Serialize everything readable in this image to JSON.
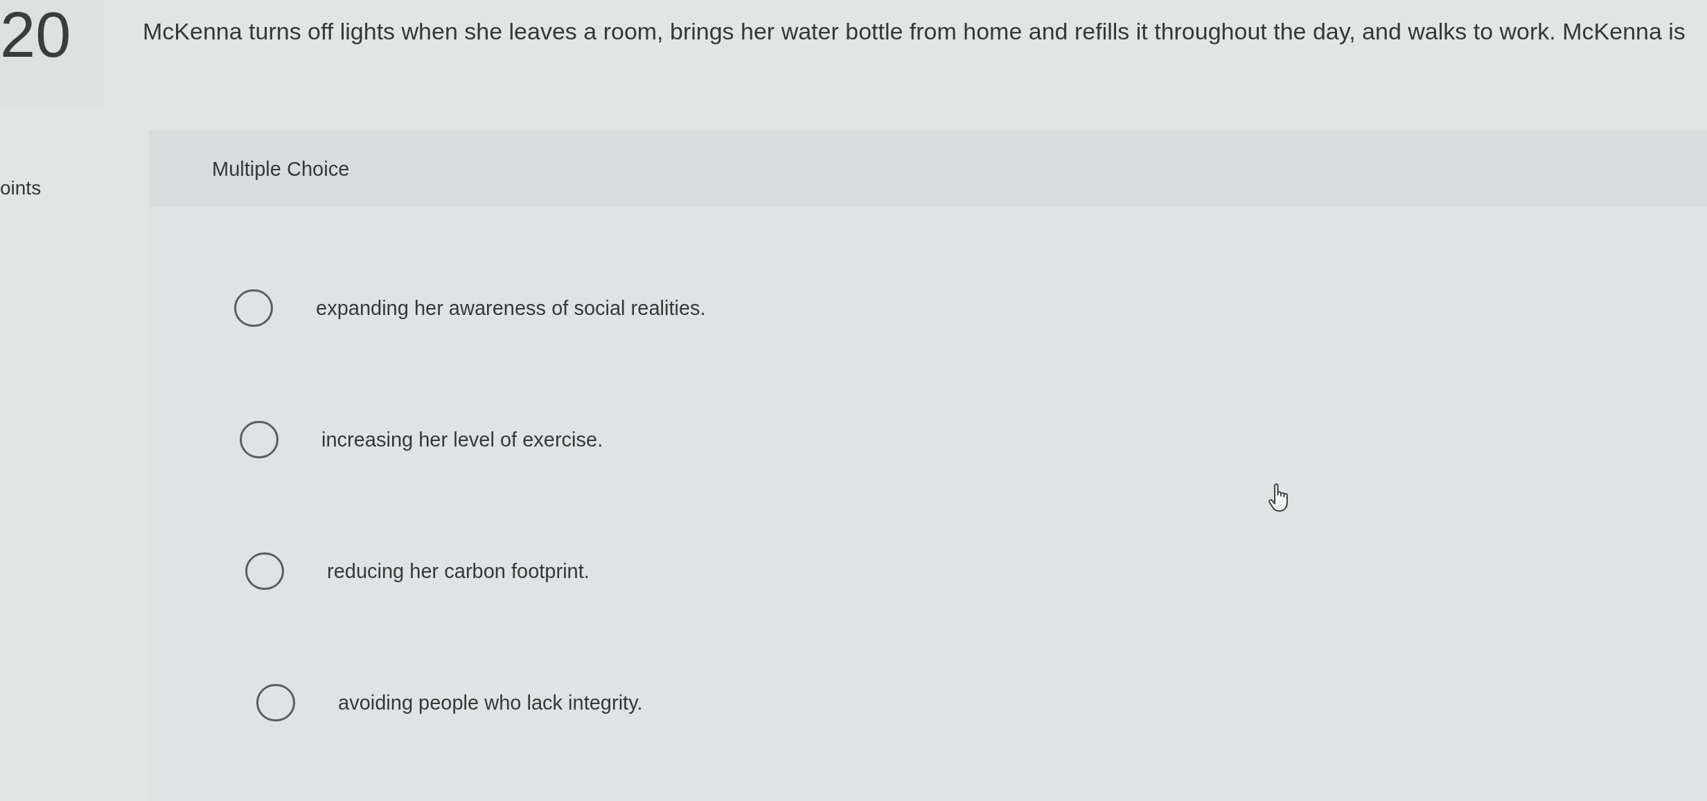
{
  "question": {
    "number": "20",
    "text": "McKenna turns off lights when she leaves a room, brings her water bottle from home and refills it throughout the day, and walks to work. McKenna is"
  },
  "points": {
    "label": "oints"
  },
  "answer_panel": {
    "type_label": "Multiple Choice",
    "options": [
      {
        "text": "expanding her awareness of social realities.",
        "selected": false
      },
      {
        "text": "increasing her level of exercise.",
        "selected": false
      },
      {
        "text": "reducing her carbon footprint.",
        "selected": false
      },
      {
        "text": "avoiding people who lack integrity.",
        "selected": false
      }
    ]
  }
}
